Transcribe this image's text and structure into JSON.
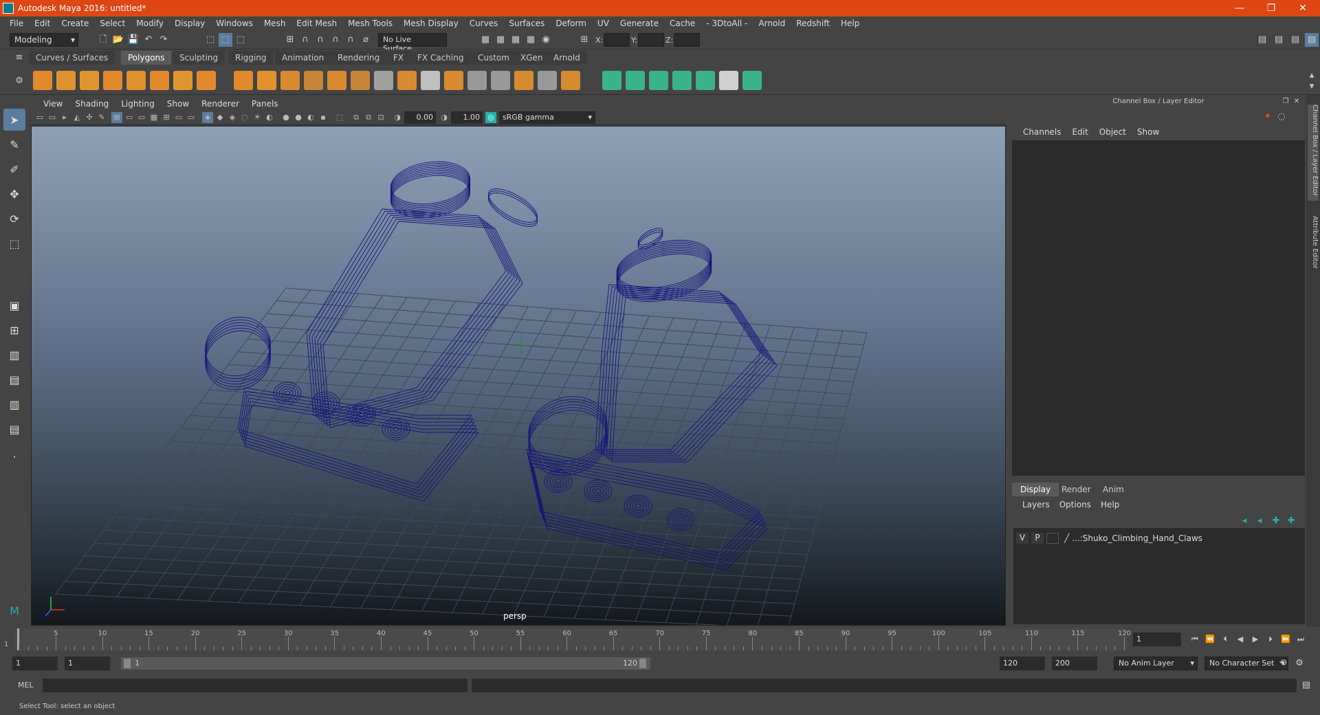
{
  "window": {
    "title": "Autodesk Maya 2016: untitled*",
    "controls": [
      "—",
      "❐",
      "✕"
    ]
  },
  "menubar": [
    "File",
    "Edit",
    "Create",
    "Select",
    "Modify",
    "Display",
    "Windows",
    "Mesh",
    "Edit Mesh",
    "Mesh Tools",
    "Mesh Display",
    "Curves",
    "Surfaces",
    "Deform",
    "UV",
    "Generate",
    "Cache",
    "- 3DtoAll -",
    "Arnold",
    "Redshift",
    "Help"
  ],
  "statusline": {
    "mode": "Modeling",
    "live_surface": "No Live Surface",
    "x_label": "X:",
    "y_label": "Y:",
    "z_label": "Z:"
  },
  "shelf_tabs": [
    "Curves / Surfaces",
    "Polygons",
    "Sculpting",
    "Rigging",
    "Animation",
    "Rendering",
    "FX",
    "FX Caching",
    "Custom",
    "XGen",
    "Arnold"
  ],
  "shelf_active": "Polygons",
  "viewport": {
    "menu": [
      "View",
      "Shading",
      "Lighting",
      "Show",
      "Renderer",
      "Panels"
    ],
    "exposure": "0.00",
    "gamma": "1.00",
    "color_space": "sRGB gamma",
    "camera_label": "persp"
  },
  "right_panel": {
    "title": "Channel Box / Layer Editor",
    "menu": [
      "Channels",
      "Edit",
      "Object",
      "Show"
    ],
    "tabs": [
      "Display",
      "Render",
      "Anim"
    ],
    "active_tab": "Display",
    "layer_menu": [
      "Layers",
      "Options",
      "Help"
    ],
    "layers": [
      {
        "v": "V",
        "p": "P",
        "name": "...:Shuko_Climbing_Hand_Claws"
      }
    ],
    "side_tabs": [
      "Channel Box / Layer Editor",
      "Attribute Editor"
    ]
  },
  "timeslider": {
    "ticks": [
      "5",
      "10",
      "15",
      "20",
      "25",
      "30",
      "35",
      "40",
      "45",
      "50",
      "55",
      "60",
      "65",
      "70",
      "75",
      "80",
      "85",
      "90",
      "95",
      "100",
      "105",
      "110",
      "115",
      "120"
    ],
    "current_label": "1",
    "current_frame_field": "1"
  },
  "range": {
    "start": "1",
    "anim_start": "1",
    "range_start": "1",
    "range_end": "120",
    "anim_end": "120",
    "end": "200",
    "anim_layer": "No Anim Layer",
    "char_set": "No Character Set"
  },
  "cmdline": {
    "label": "MEL"
  },
  "helpline": {
    "text": "Select Tool: select an object"
  }
}
